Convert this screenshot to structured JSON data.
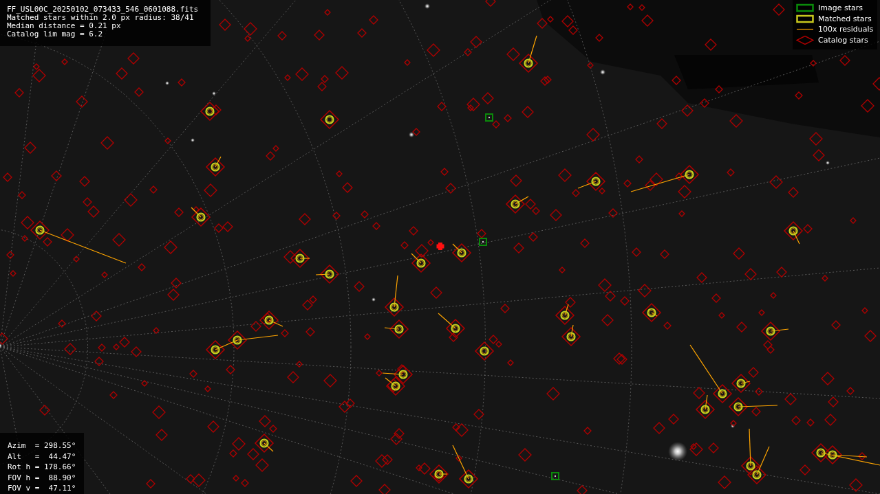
{
  "info_panel": {
    "lines": [
      "FF_USL00C_20250102_073433_546_0601088.fits",
      "Matched stars within 2.0 px radius: 38/41",
      "Median distance = 0.21 px",
      "Catalog lim mag = 6.2"
    ]
  },
  "camera_panel": {
    "lines": [
      "Azim  = 298.55°",
      "Alt   =  44.47°",
      "Rot h = 178.66°",
      "FOV h =  88.90°",
      "FOV v =  47.11°"
    ]
  },
  "legend": {
    "items": [
      {
        "label": "Image stars",
        "kind": "image",
        "color": "#0a8a0a"
      },
      {
        "label": "Matched stars",
        "kind": "matched",
        "color": "#c8c81e"
      },
      {
        "label": "100x residuals",
        "kind": "residual",
        "color": "#ffa500"
      },
      {
        "label": "Catalog stars",
        "kind": "catalog",
        "color": "#aa0000"
      }
    ]
  }
}
